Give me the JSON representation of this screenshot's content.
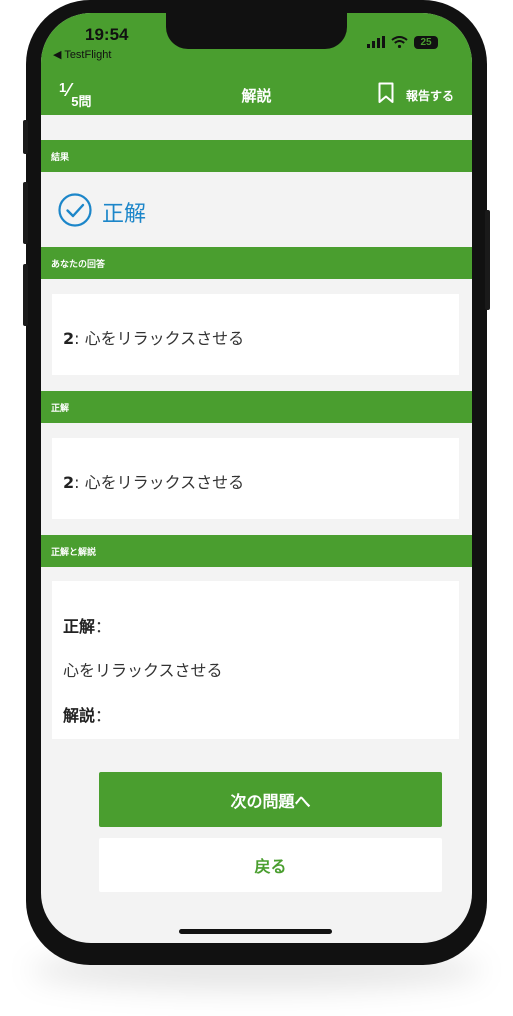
{
  "status_bar": {
    "time": "19:54",
    "back_app": "◀ TestFlight",
    "battery": "25"
  },
  "nav": {
    "progress_current": "1",
    "progress_total": "5問",
    "title": "解説",
    "report_label": "報告する"
  },
  "sections": {
    "result": {
      "header": "結果",
      "status": "正解",
      "is_correct": true
    },
    "your_answer": {
      "header": "あなたの回答",
      "number": "2",
      "text": ": 心をリラックスさせる"
    },
    "correct": {
      "header": "正解",
      "number": "2",
      "text": ": 心をリラックスさせる"
    },
    "explanation": {
      "header": "正解と解説",
      "answer_label": "正解",
      "answer_sep": "：",
      "answer_text": "心をリラックスさせる",
      "explanation_label": "解説",
      "explanation_sep": "："
    }
  },
  "buttons": {
    "next": "次の問題へ",
    "back": "戻る"
  },
  "colors": {
    "accent_green": "#4a9e2f",
    "correct_blue": "#1c86c9",
    "background": "#f3f3f3"
  },
  "icons": {
    "bookmark": "bookmark-icon",
    "check": "check-circle-icon",
    "signal": "signal-icon",
    "wifi": "wifi-icon"
  }
}
